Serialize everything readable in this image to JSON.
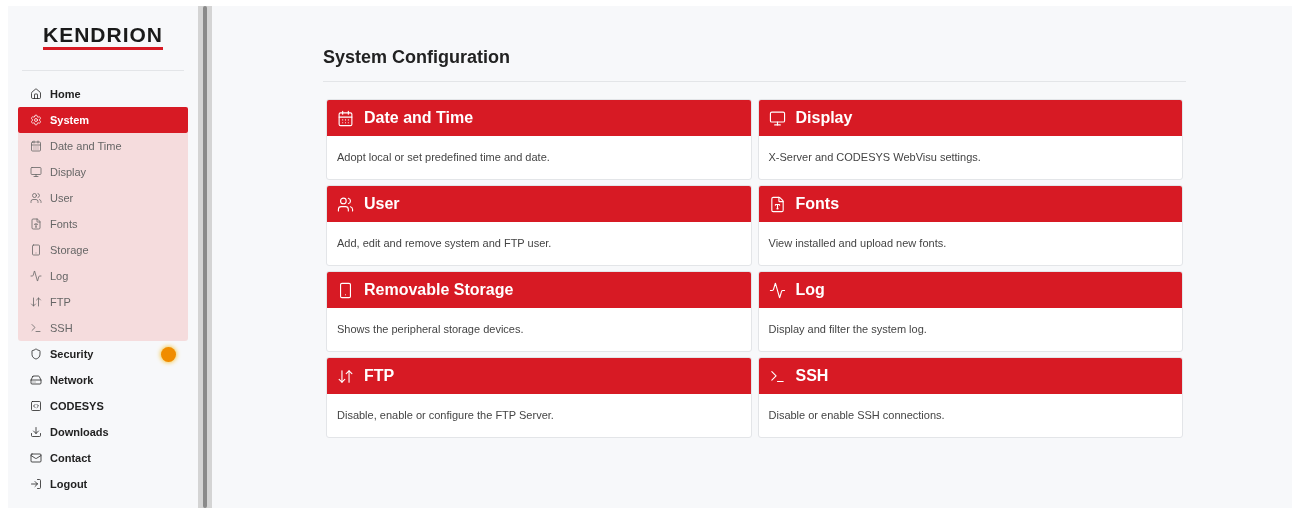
{
  "sidebar": {
    "logo": "KENDRION",
    "items": [
      {
        "label": "Home",
        "selected": false,
        "notification": false
      },
      {
        "label": "System",
        "selected": true,
        "notification": false,
        "expanded": true,
        "children": [
          {
            "label": "Date and Time",
            "selected": false
          },
          {
            "label": "Display",
            "selected": false
          },
          {
            "label": "User",
            "selected": false
          },
          {
            "label": "Fonts",
            "selected": false
          },
          {
            "label": "Storage",
            "selected": false
          },
          {
            "label": "Log",
            "selected": false
          },
          {
            "label": "FTP",
            "selected": false
          },
          {
            "label": "SSH",
            "selected": false
          }
        ]
      },
      {
        "label": "Security",
        "selected": false,
        "notification": true
      },
      {
        "label": "Network",
        "selected": false,
        "notification": false
      },
      {
        "label": "CODESYS",
        "selected": false,
        "notification": false
      },
      {
        "label": "Downloads",
        "selected": false,
        "notification": false
      },
      {
        "label": "Contact",
        "selected": false,
        "notification": false
      },
      {
        "label": "Logout",
        "selected": false,
        "notification": false
      }
    ]
  },
  "main": {
    "title": "System Configuration",
    "cards": [
      {
        "title": "Date and Time",
        "description": "Adopt local or set predefined time and date."
      },
      {
        "title": "Display",
        "description": "X-Server and CODESYS WebVisu settings."
      },
      {
        "title": "User",
        "description": "Add, edit and remove system and FTP user."
      },
      {
        "title": "Fonts",
        "description": "View installed and upload new fonts."
      },
      {
        "title": "Removable Storage",
        "description": "Shows the peripheral storage devices."
      },
      {
        "title": "Log",
        "description": "Display and filter the system log."
      },
      {
        "title": "FTP",
        "description": "Disable, enable or configure the FTP Server."
      },
      {
        "title": "SSH",
        "description": "Disable or enable SSH connections."
      }
    ]
  }
}
